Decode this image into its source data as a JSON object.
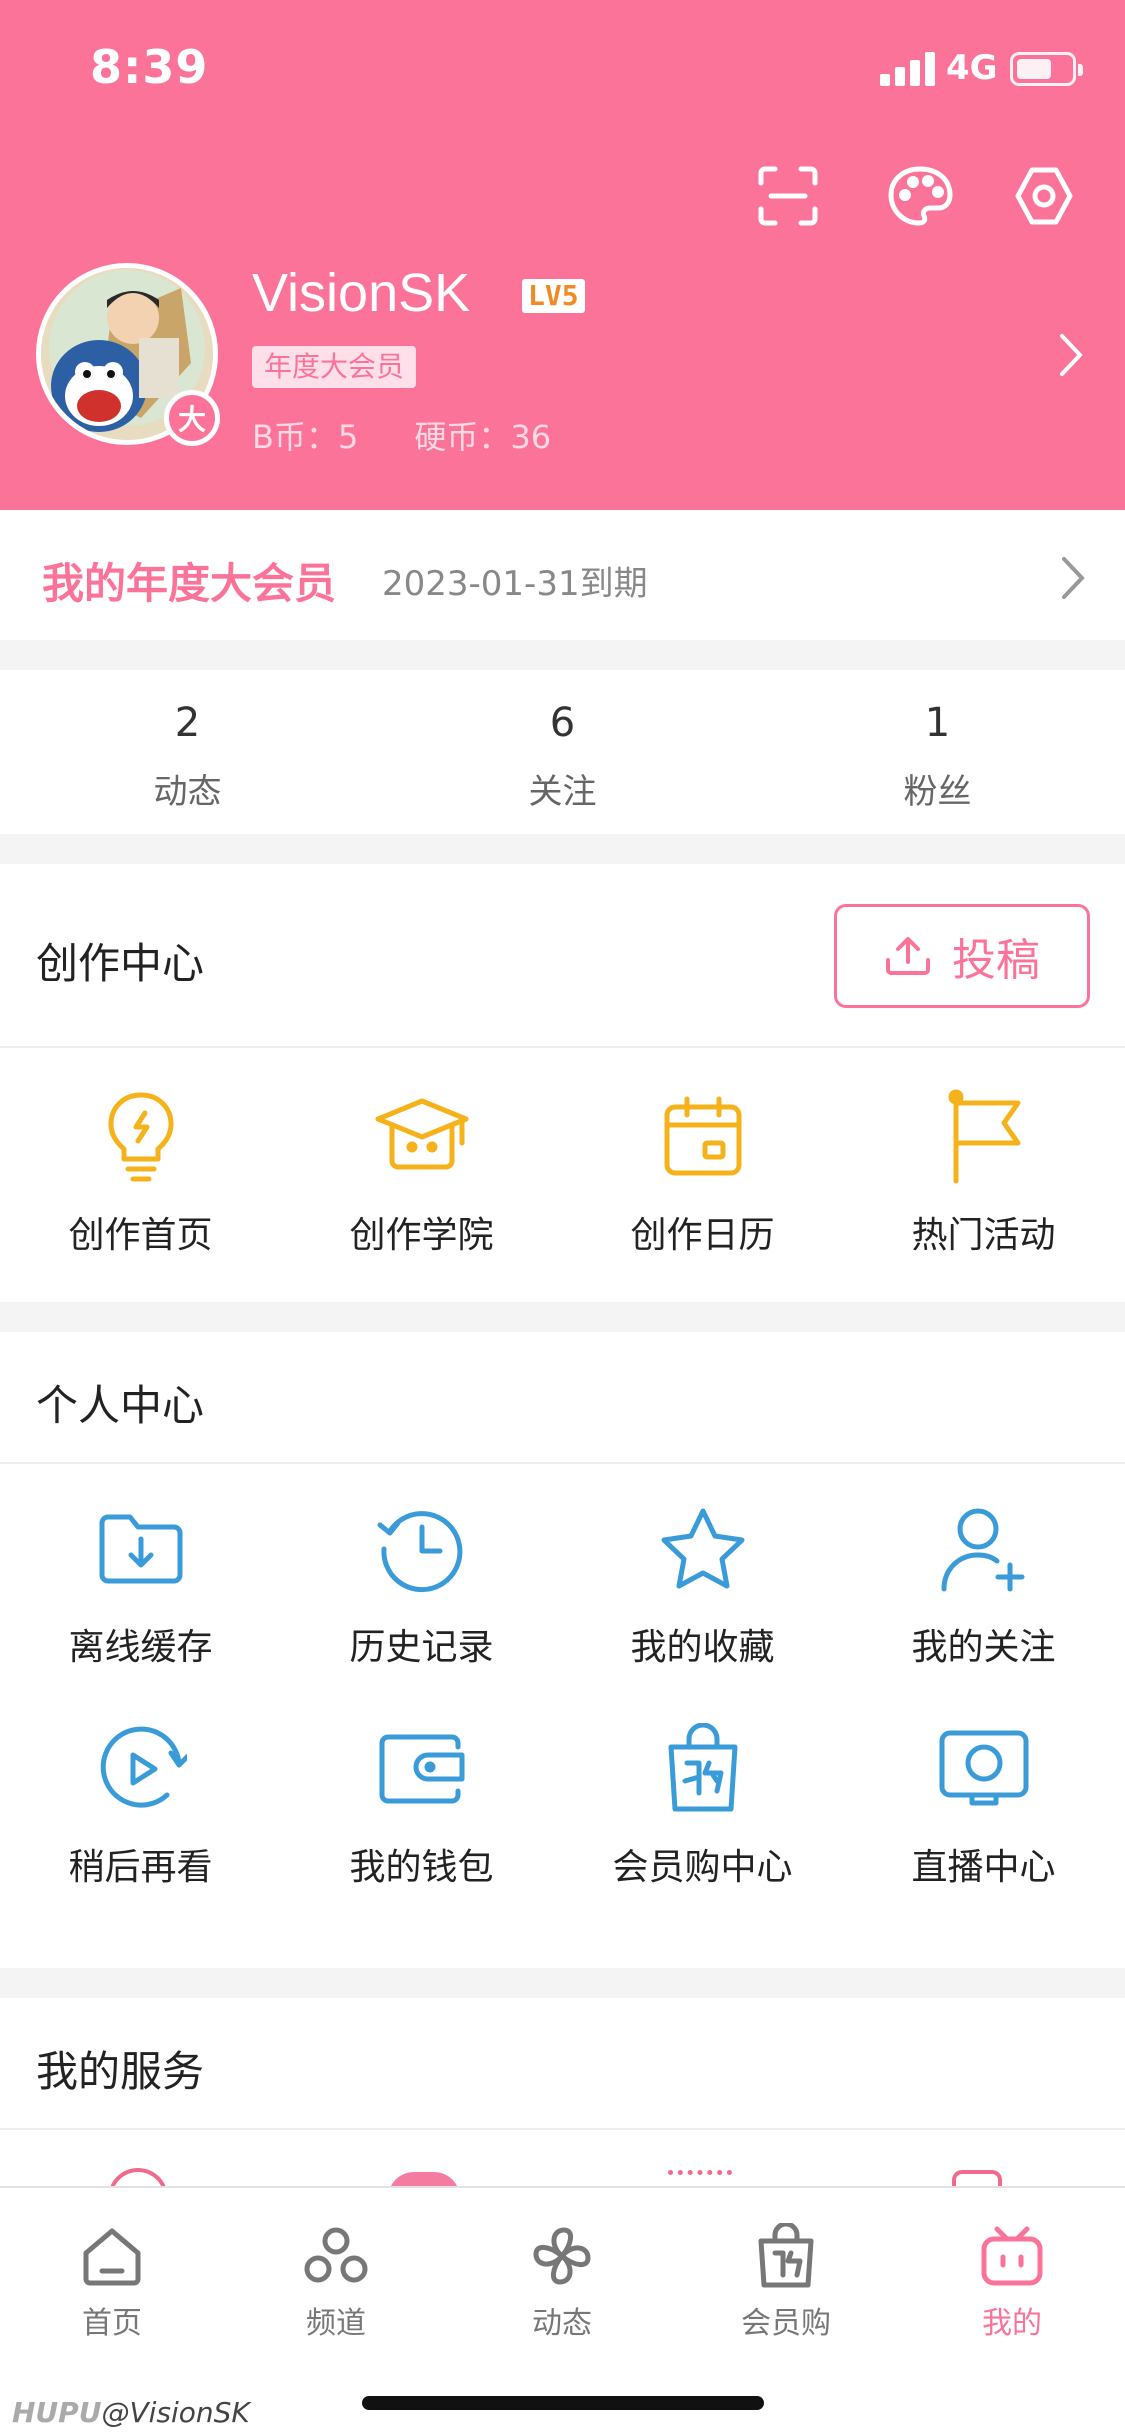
{
  "status_bar": {
    "time": "8:39",
    "network": "4G"
  },
  "profile": {
    "username": "VisionSK",
    "level": "LV5",
    "vip_tag": "年度大会员",
    "vip_badge": "大",
    "b_coin": "B币：5",
    "hard_coin": "硬币：36"
  },
  "vip_bar": {
    "title": "我的年度大会员",
    "expiry": "2023-01-31到期"
  },
  "stats": [
    {
      "num": "2",
      "label": "动态"
    },
    {
      "num": "6",
      "label": "关注"
    },
    {
      "num": "1",
      "label": "粉丝"
    }
  ],
  "creation": {
    "title": "创作中心",
    "upload_label": "投稿",
    "items": [
      {
        "label": "创作首页",
        "icon": "lightbulb-icon"
      },
      {
        "label": "创作学院",
        "icon": "graduation-cap-icon"
      },
      {
        "label": "创作日历",
        "icon": "calendar-icon"
      },
      {
        "label": "热门活动",
        "icon": "flag-icon"
      }
    ]
  },
  "personal": {
    "title": "个人中心",
    "items": [
      {
        "label": "离线缓存",
        "icon": "download-folder-icon"
      },
      {
        "label": "历史记录",
        "icon": "history-clock-icon"
      },
      {
        "label": "我的收藏",
        "icon": "star-icon"
      },
      {
        "label": "我的关注",
        "icon": "add-user-icon"
      },
      {
        "label": "稍后再看",
        "icon": "play-later-icon"
      },
      {
        "label": "我的钱包",
        "icon": "wallet-icon"
      },
      {
        "label": "会员购中心",
        "icon": "shopping-bag-icon"
      },
      {
        "label": "直播中心",
        "icon": "live-tv-icon"
      }
    ]
  },
  "services": {
    "title": "我的服务"
  },
  "tabbar": [
    {
      "label": "首页",
      "icon": "home-icon"
    },
    {
      "label": "频道",
      "icon": "channels-icon"
    },
    {
      "label": "动态",
      "icon": "pinwheel-icon"
    },
    {
      "label": "会员购",
      "icon": "shopping-bag-icon"
    },
    {
      "label": "我的",
      "icon": "tv-mascot-icon"
    }
  ],
  "watermark": {
    "brand": "HUPU",
    "user": "@VisionSK"
  },
  "colors": {
    "brand_pink": "#fb7399",
    "icon_yellow": "#f5b21b",
    "icon_blue": "#3a9bd9"
  }
}
